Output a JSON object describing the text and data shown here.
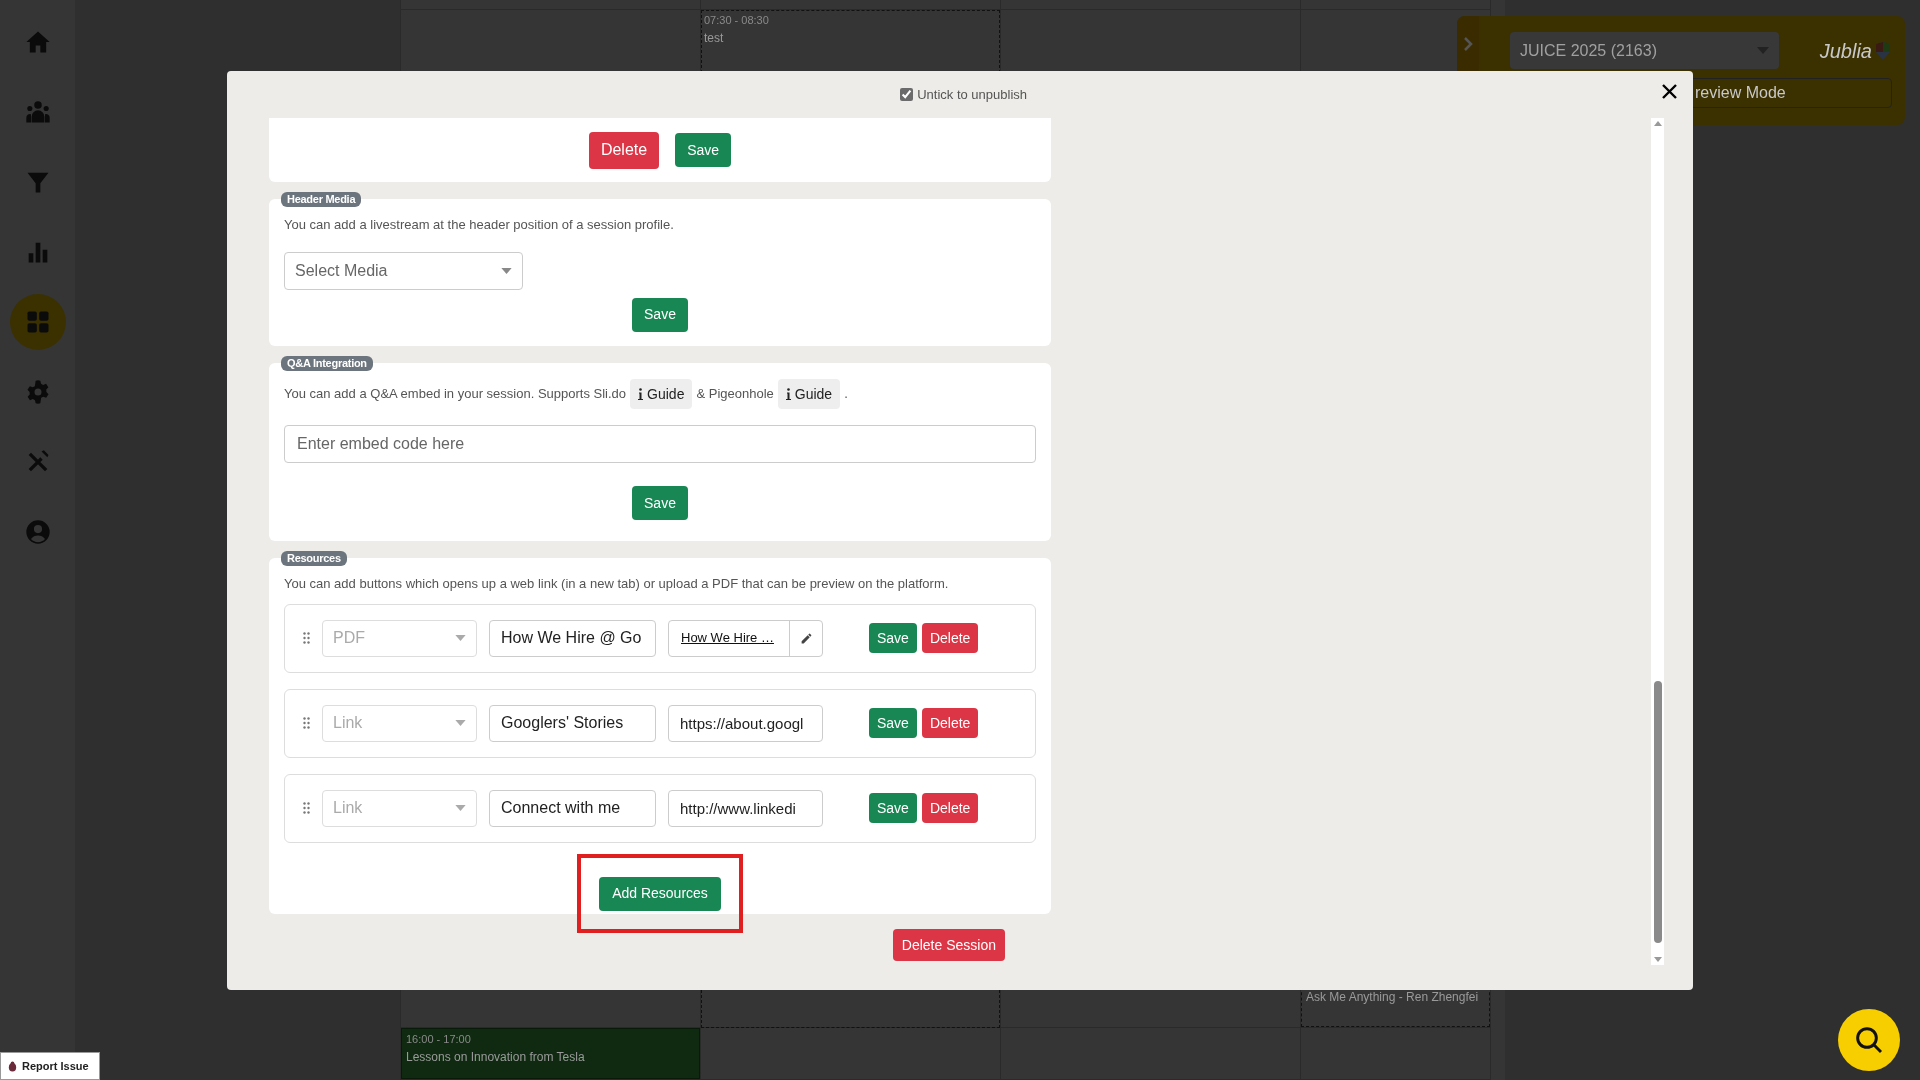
{
  "sidebar": {
    "items": [
      {
        "selected": false
      },
      {
        "selected": false
      },
      {
        "selected": false
      },
      {
        "selected": false
      },
      {
        "selected": true
      },
      {
        "selected": false
      },
      {
        "selected": false
      },
      {
        "selected": false
      }
    ]
  },
  "calendar": {
    "events": [
      {
        "time": "07:30 - 08:30",
        "title": "test"
      },
      {
        "title": "Ask Me Anything - Ren Zhengfei"
      },
      {
        "time": "16:00 - 17:00",
        "title": "Lessons on Innovation from Tesla"
      }
    ]
  },
  "top_panel": {
    "event_select": "JUICE 2025 (2163)",
    "brand": "Jublia",
    "preview_button": "review Mode"
  },
  "report_issue": "Report Issue",
  "modal": {
    "publish": {
      "label": "Untick to unpublish",
      "checked": true
    },
    "top_section": {
      "buttons": [
        "Delete",
        "Save"
      ]
    },
    "header_media": {
      "badge": "Header Media",
      "description": "You can add a livestream at the header position of a session profile.",
      "select_placeholder": "Select Media",
      "save": "Save"
    },
    "qa": {
      "badge": "Q&A Integration",
      "description_1": "You can add a Q&A embed in your session. Supports Sli.do",
      "guide_1": "Guide",
      "description_2": "& Pigeonhole",
      "guide_2": "Guide",
      "description_3": ".",
      "placeholder": "Enter embed code here",
      "save": "Save"
    },
    "resources": {
      "badge": "Resources",
      "description": "You can add buttons which opens up a web link (in a new tab) or upload a PDF that can be preview on the platform.",
      "rows": [
        {
          "kind": "file",
          "type": "PDF",
          "title": "How We Hire @ Go",
          "target": "How We Hire …",
          "save": "Save",
          "delete": "Delete"
        },
        {
          "kind": "url",
          "type": "Link",
          "title": "Googlers' Stories",
          "target": "https://about.googl",
          "save": "Save",
          "delete": "Delete"
        },
        {
          "kind": "url",
          "type": "Link",
          "title": "Connect with me",
          "target": "http://www.linkedi",
          "save": "Save",
          "delete": "Delete"
        }
      ],
      "add": "Add Resources",
      "add_highlighted": true
    },
    "delete_session": "Delete Session"
  }
}
